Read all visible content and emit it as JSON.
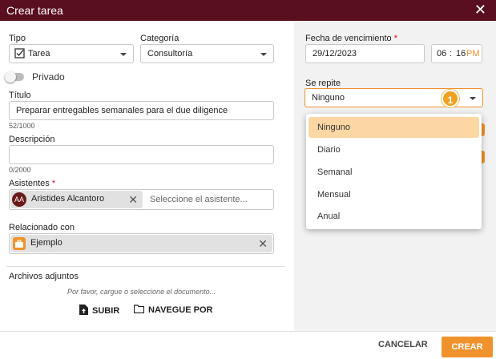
{
  "dialog": {
    "title": "Crear tarea"
  },
  "tipo": {
    "label": "Tipo",
    "value": "Tarea"
  },
  "categoria": {
    "label": "Categoría",
    "value": "Consultoría"
  },
  "privado": {
    "label": "Privado"
  },
  "titulo": {
    "label": "Título",
    "value": "Preparar entregables semanales para el due diligence",
    "counter": "52/1000"
  },
  "descripcion": {
    "label": "Descripción",
    "value": "",
    "counter": "0/2000"
  },
  "asistentes": {
    "label": "Asistentes",
    "required_mark": "*",
    "chip_initials": "AA",
    "chip_name": "Aristides Alcantoro",
    "placeholder": "Seleccione el asistente..."
  },
  "relacionado": {
    "label": "Relacionado con",
    "chip_name": "Ejemplo"
  },
  "archivos": {
    "label": "Archivos adjuntos",
    "hint": "Por favor, cargue o seleccione el documento...",
    "upload_label": "SUBIR",
    "browse_label": "NAVEGUE POR"
  },
  "fecha": {
    "label": "Fecha de vencimiento",
    "required_mark": "*",
    "date": "29/12/2023",
    "hour": "06",
    "sep": ":",
    "minute": "16",
    "ampm": "PM"
  },
  "repite": {
    "label": "Se repite",
    "value": "Ninguno",
    "options": [
      "Ninguno",
      "Diario",
      "Semanal",
      "Mensual",
      "Anual"
    ],
    "selected_index": 0
  },
  "step_badge": "1",
  "footer": {
    "cancel_label": "CANCELAR",
    "create_label": "CREAR"
  },
  "colors": {
    "header_bg": "#5a0f1e",
    "accent": "#f0922b",
    "selected_option": "#fcd7a4",
    "badge": "#f0a020"
  },
  "icons": {
    "close": "close-icon",
    "checkbox": "checkbox-icon",
    "upload": "file-upload-icon",
    "folder": "folder-icon",
    "briefcase": "briefcase-icon"
  }
}
